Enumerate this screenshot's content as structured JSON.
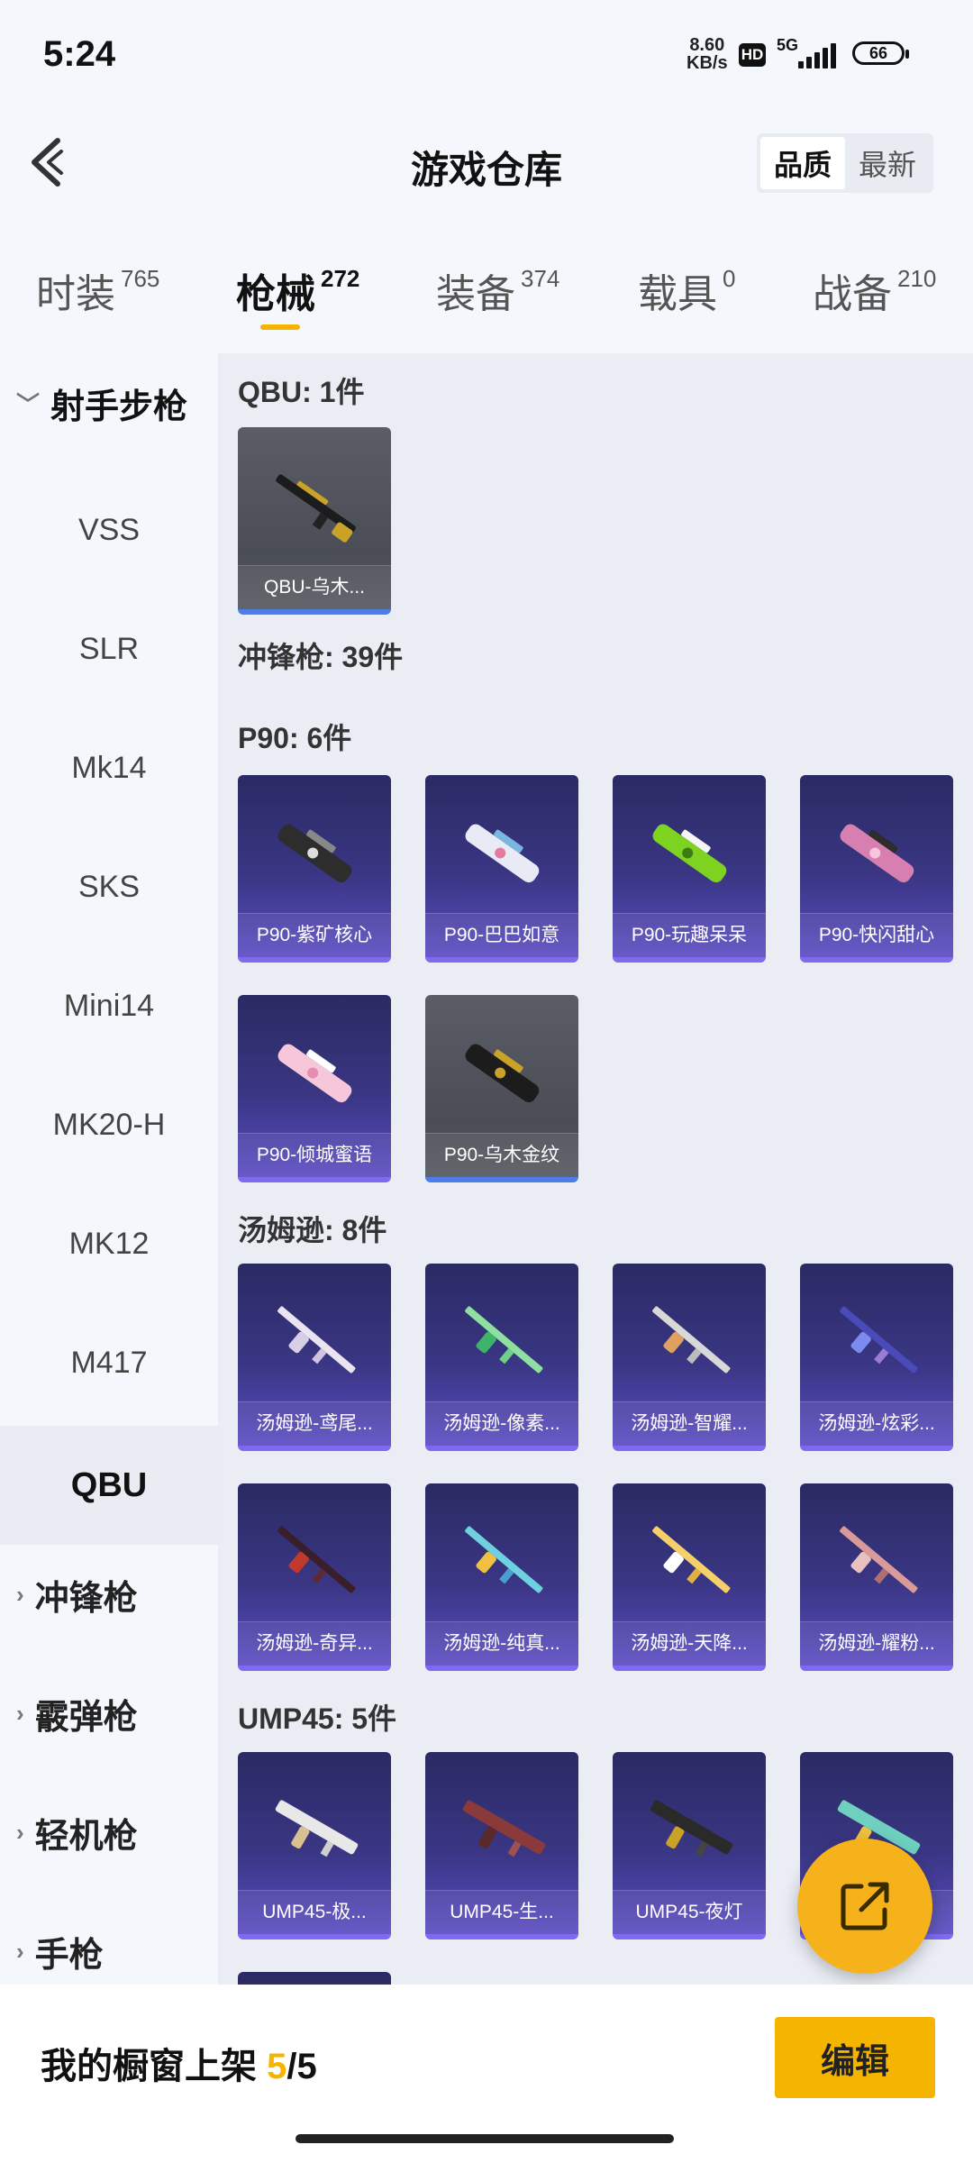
{
  "status_bar": {
    "time": "5:24",
    "net_speed": "8.60",
    "net_unit": "KB/s",
    "hd": "HD",
    "signal": "5G",
    "battery": "66"
  },
  "header": {
    "title": "游戏仓库",
    "sort": [
      "品质",
      "最新"
    ],
    "sort_active": "品质"
  },
  "tabs": [
    {
      "label": "时装",
      "count": "765"
    },
    {
      "label": "枪械",
      "count": "272",
      "active": true
    },
    {
      "label": "装备",
      "count": "374"
    },
    {
      "label": "载具",
      "count": "0"
    },
    {
      "label": "战备",
      "count": "210"
    }
  ],
  "sidebar": {
    "open_group": "射手步枪",
    "items": [
      "VSS",
      "SLR",
      "Mk14",
      "SKS",
      "Mini14",
      "MK20-H",
      "MK12",
      "M417",
      "QBU"
    ],
    "active_item": "QBU",
    "groups": [
      "冲锋枪",
      "霰弹枪",
      "轻机枪",
      "手枪"
    ]
  },
  "sections": {
    "qbu": {
      "title": "QBU: 1件",
      "cards": [
        "QBU-乌木..."
      ]
    },
    "smg": {
      "title": "冲锋枪: 39件"
    },
    "p90": {
      "title": "P90: 6件",
      "cards": [
        "P90-紫矿核心",
        "P90-巴巴如意",
        "P90-玩趣呆呆",
        "P90-快闪甜心",
        "P90-倾城蜜语",
        "P90-乌木金纹"
      ]
    },
    "thompson": {
      "title": "汤姆逊: 8件",
      "cards": [
        "汤姆逊-鸢尾...",
        "汤姆逊-像素...",
        "汤姆逊-智耀...",
        "汤姆逊-炫彩...",
        "汤姆逊-奇异...",
        "汤姆逊-纯真...",
        "汤姆逊-天降...",
        "汤姆逊-耀粉..."
      ]
    },
    "ump": {
      "title": "UMP45: 5件",
      "cards": [
        "UMP45-极...",
        "UMP45-生...",
        "UMP45-夜灯",
        "..."
      ]
    }
  },
  "colors": {
    "accent": "#f5b400",
    "card_purple": "#3a3684",
    "card_gray": "#4a4d55"
  },
  "bottom": {
    "showcase_label": "我的橱窗上架",
    "showcase_current": "5",
    "showcase_total": "/5",
    "edit_label": "编辑"
  }
}
